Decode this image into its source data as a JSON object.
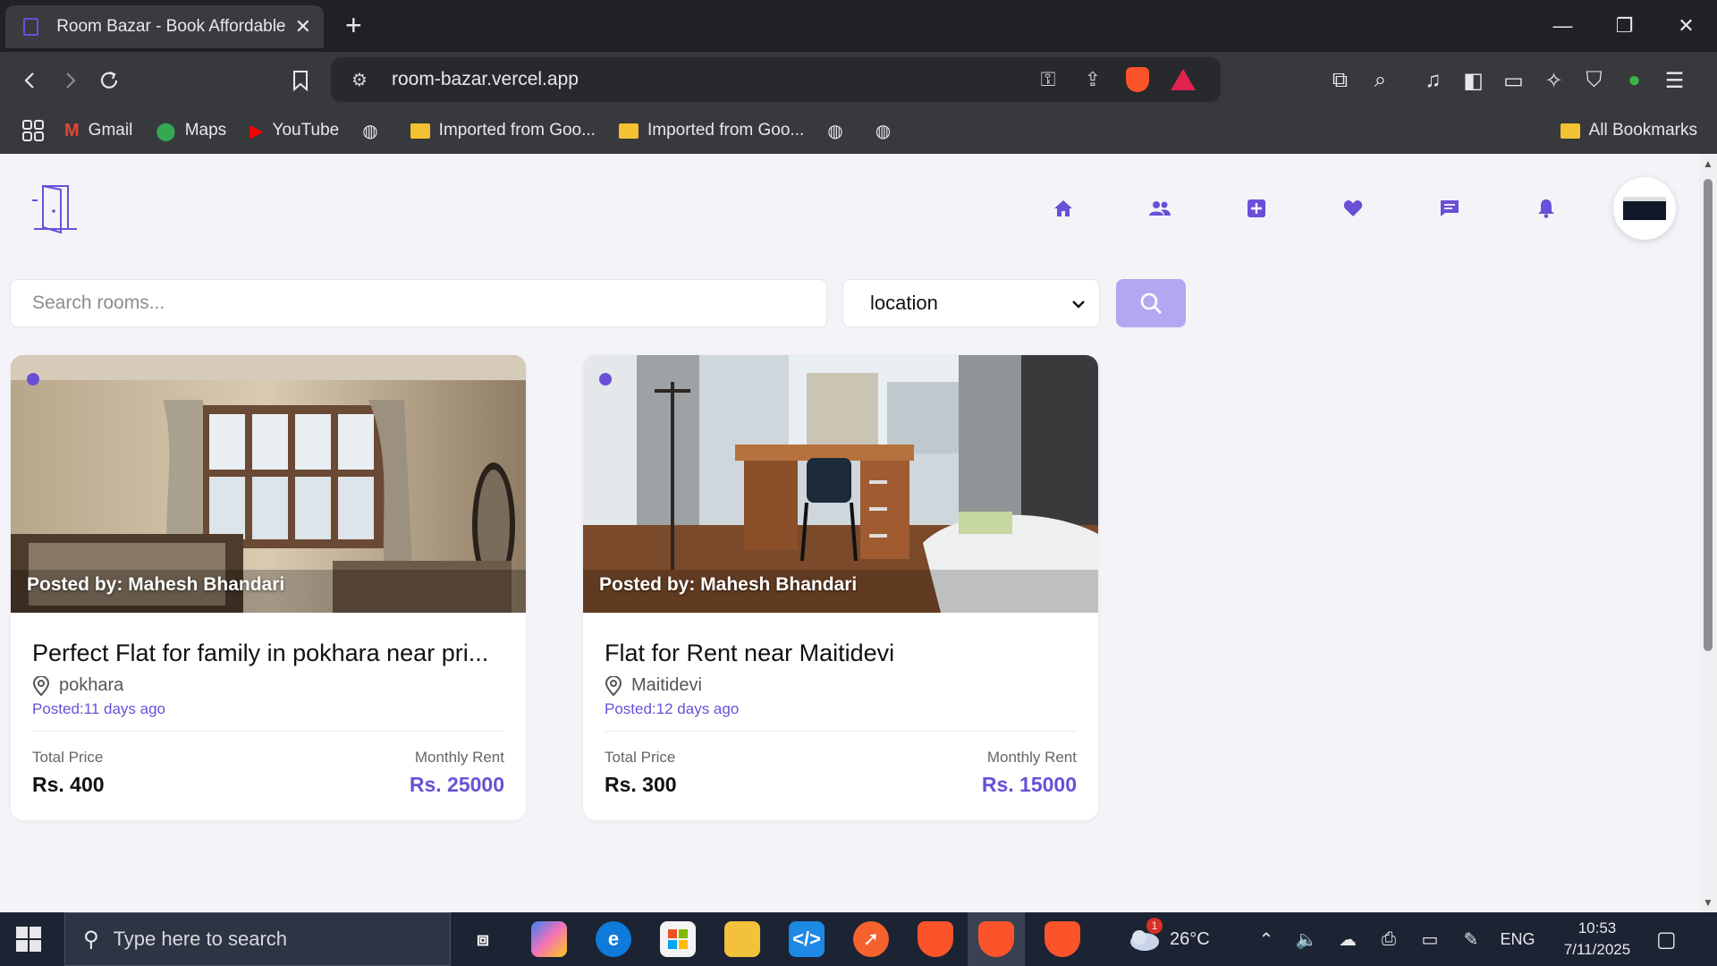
{
  "browser": {
    "tab_title": "Room Bazar - Book Affordable R",
    "url": "room-bazar.vercel.app",
    "bookmarks": [
      {
        "label": "Gmail",
        "icon": "gmail-icon"
      },
      {
        "label": "Maps",
        "icon": "maps-icon"
      },
      {
        "label": "YouTube",
        "icon": "youtube-icon"
      },
      {
        "label": "Imported from Goo...",
        "icon": "folder-icon"
      },
      {
        "label": "Imported from Goo...",
        "icon": "folder-icon"
      }
    ],
    "all_bookmarks": "All Bookmarks"
  },
  "app": {
    "nav": [
      "home-icon",
      "users-icon",
      "add-square-icon",
      "heart-icon",
      "chat-icon",
      "bell-icon"
    ],
    "accent_color": "#6a4fd8",
    "search": {
      "placeholder": "Search rooms...",
      "location_selected": "location"
    },
    "listings": [
      {
        "posted_by": "Posted by: Mahesh Bhandari",
        "title": "Perfect Flat for family in pokhara near pri...",
        "location": "pokhara",
        "posted": "Posted:11 days ago",
        "total_price_label": "Total Price",
        "total_price": "Rs. 400",
        "monthly_rent_label": "Monthly Rent",
        "monthly_rent": "Rs. 25000"
      },
      {
        "posted_by": "Posted by: Mahesh Bhandari",
        "title": "Flat for Rent near Maitidevi",
        "location": "Maitidevi",
        "posted": "Posted:12 days ago",
        "total_price_label": "Total Price",
        "total_price": "Rs. 300",
        "monthly_rent_label": "Monthly Rent",
        "monthly_rent": "Rs. 15000"
      }
    ]
  },
  "taskbar": {
    "search_placeholder": "Type here to search",
    "weather": "26°C",
    "language": "ENG",
    "time": "10:53",
    "date": "7/11/2025",
    "notification_count": "1"
  }
}
